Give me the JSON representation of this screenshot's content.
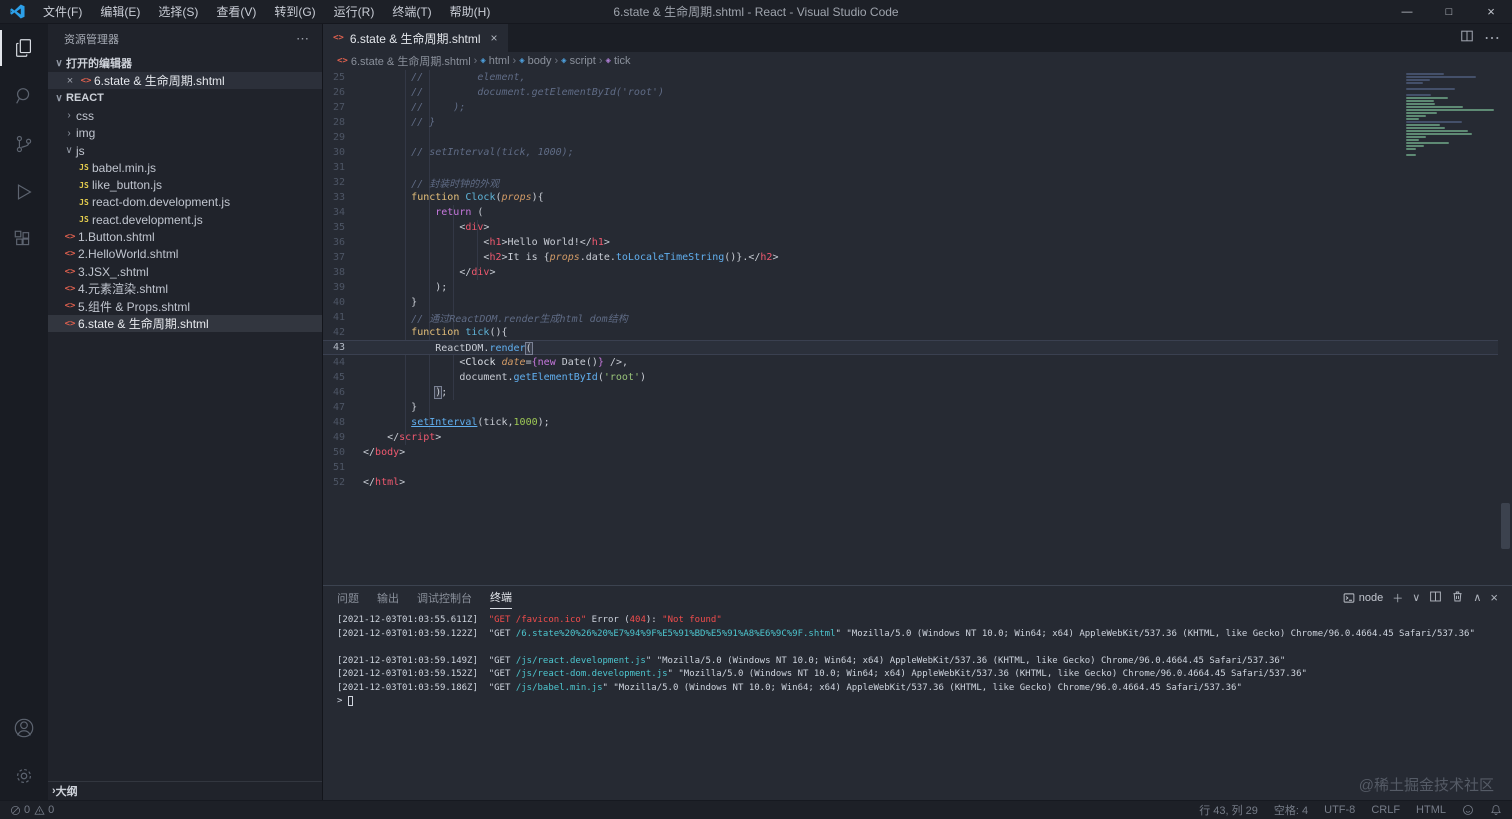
{
  "window": {
    "title": "6.state & 生命周期.shtml - React - Visual Studio Code"
  },
  "icons": {
    "more": "⋯",
    "close": "×",
    "minimize": "—",
    "maximize": "□",
    "chevron_down": "∨",
    "chevron_up": "∧",
    "chevron_right": "›",
    "plus": "＋",
    "code_badge": "<>",
    "js_badge": "JS"
  },
  "menu": {
    "items": [
      "文件(F)",
      "编辑(E)",
      "选择(S)",
      "查看(V)",
      "转到(G)",
      "运行(R)",
      "终端(T)",
      "帮助(H)"
    ]
  },
  "activity_bar": {
    "items": [
      "explorer",
      "search",
      "source-control",
      "run-debug",
      "extensions"
    ],
    "bottom": [
      "account",
      "settings"
    ]
  },
  "sidebar": {
    "title": "资源管理器",
    "open_editors_label": "打开的编辑器",
    "open_editor_file": "6.state & 生命周期.shtml",
    "project_label": "REACT",
    "tree": [
      {
        "type": "folder",
        "name": "css",
        "depth": 1,
        "expanded": false
      },
      {
        "type": "folder",
        "name": "img",
        "depth": 1,
        "expanded": false
      },
      {
        "type": "folder",
        "name": "js",
        "depth": 1,
        "expanded": true
      },
      {
        "type": "js",
        "name": "babel.min.js",
        "depth": 2
      },
      {
        "type": "js",
        "name": "like_button.js",
        "depth": 2
      },
      {
        "type": "js",
        "name": "react-dom.development.js",
        "depth": 2
      },
      {
        "type": "js",
        "name": "react.development.js",
        "depth": 2
      },
      {
        "type": "code",
        "name": "1.Button.shtml",
        "depth": 1
      },
      {
        "type": "code",
        "name": "2.HelloWorld.shtml",
        "depth": 1
      },
      {
        "type": "code",
        "name": "3.JSX_.shtml",
        "depth": 1
      },
      {
        "type": "code",
        "name": "4.元素渲染.shtml",
        "depth": 1
      },
      {
        "type": "code",
        "name": "5.组件 & Props.shtml",
        "depth": 1
      },
      {
        "type": "code",
        "name": "6.state & 生命周期.shtml",
        "depth": 1,
        "selected": true
      }
    ],
    "outline_label": "大纲"
  },
  "editor": {
    "tab": {
      "name": "6.state & 生命周期.shtml"
    },
    "breadcrumb": [
      {
        "label": "6.state & 生命周期.shtml",
        "icon": "code-file",
        "color": "#e0614f"
      },
      {
        "label": "html",
        "icon": "symbol-element",
        "color": "#4ea1df"
      },
      {
        "label": "body",
        "icon": "symbol-element",
        "color": "#4ea1df"
      },
      {
        "label": "script",
        "icon": "symbol-element",
        "color": "#4ea1df"
      },
      {
        "label": "tick",
        "icon": "symbol-method",
        "color": "#b180d7"
      }
    ],
    "active_line": 43,
    "lines": [
      {
        "n": 25,
        "t": [
          [
            "cm",
            "        //         element,"
          ]
        ]
      },
      {
        "n": 26,
        "t": [
          [
            "cm",
            "        //         document.getElementById('root')"
          ]
        ]
      },
      {
        "n": 27,
        "t": [
          [
            "cm",
            "        //     );"
          ]
        ]
      },
      {
        "n": 28,
        "t": [
          [
            "cm",
            "        // }"
          ]
        ]
      },
      {
        "n": 29,
        "t": []
      },
      {
        "n": 30,
        "t": [
          [
            "cm",
            "        // setInterval(tick, 1000);"
          ]
        ]
      },
      {
        "n": 31,
        "t": []
      },
      {
        "n": 32,
        "t": [
          [
            "cm",
            "        // 封装时钟的外观"
          ]
        ]
      },
      {
        "n": 33,
        "t": [
          [
            "pl",
            "        "
          ],
          [
            "fk",
            "function"
          ],
          [
            "pl",
            " "
          ],
          [
            "fn",
            "Clock"
          ],
          [
            "pl",
            "("
          ],
          [
            "at",
            "props"
          ],
          [
            "pl",
            "){"
          ]
        ]
      },
      {
        "n": 34,
        "t": [
          [
            "pl",
            "            "
          ],
          [
            "kw",
            "return"
          ],
          [
            "pl",
            " ("
          ]
        ]
      },
      {
        "n": 35,
        "t": [
          [
            "pl",
            "                <"
          ],
          [
            "tag",
            "div"
          ],
          [
            "pl",
            ">"
          ]
        ]
      },
      {
        "n": 36,
        "t": [
          [
            "pl",
            "                    <"
          ],
          [
            "tag",
            "h1"
          ],
          [
            "pl",
            ">Hello World!</"
          ],
          [
            "tag",
            "h1"
          ],
          [
            "pl",
            ">"
          ]
        ]
      },
      {
        "n": 37,
        "t": [
          [
            "pl",
            "                    <"
          ],
          [
            "tag",
            "h2"
          ],
          [
            "pl",
            ">It is {"
          ],
          [
            "at",
            "props"
          ],
          [
            "pl",
            ".date."
          ],
          [
            "mt",
            "toLocaleTimeString"
          ],
          [
            "pl",
            "()}.</"
          ],
          [
            "tag",
            "h2"
          ],
          [
            "pl",
            ">"
          ]
        ]
      },
      {
        "n": 38,
        "t": [
          [
            "pl",
            "                </"
          ],
          [
            "tag",
            "div"
          ],
          [
            "pl",
            ">"
          ]
        ]
      },
      {
        "n": 39,
        "t": [
          [
            "pl",
            "            );"
          ]
        ]
      },
      {
        "n": 40,
        "t": [
          [
            "pl",
            "        }"
          ]
        ]
      },
      {
        "n": 41,
        "t": [
          [
            "cm",
            "        // 通过ReactDOM.render生成html dom结构"
          ]
        ]
      },
      {
        "n": 42,
        "t": [
          [
            "pl",
            "        "
          ],
          [
            "fk",
            "function"
          ],
          [
            "pl",
            " "
          ],
          [
            "fn",
            "tick"
          ],
          [
            "pl",
            "(){"
          ]
        ]
      },
      {
        "n": 43,
        "t": [
          [
            "pl",
            "            ReactDOM."
          ],
          [
            "mt",
            "render"
          ],
          [
            "bx",
            "("
          ],
          [
            "cur",
            ""
          ]
        ]
      },
      {
        "n": 44,
        "t": [
          [
            "pl",
            "                <"
          ],
          [
            "cp",
            "Clock"
          ],
          [
            "pl",
            " "
          ],
          [
            "at",
            "date"
          ],
          [
            "pl",
            "="
          ],
          [
            "br",
            "{"
          ],
          [
            "kw",
            "new"
          ],
          [
            "pl",
            " Date()"
          ],
          [
            "br",
            "}"
          ],
          [
            "pl",
            " />,"
          ]
        ]
      },
      {
        "n": 45,
        "t": [
          [
            "pl",
            "                document."
          ],
          [
            "mt",
            "getElementById"
          ],
          [
            "pl",
            "("
          ],
          [
            "st",
            "'root'"
          ],
          [
            "pl",
            ")"
          ]
        ]
      },
      {
        "n": 46,
        "t": [
          [
            "pl",
            "            "
          ],
          [
            "bx",
            ")"
          ],
          [
            "pl",
            ";"
          ]
        ]
      },
      {
        "n": 47,
        "t": [
          [
            "pl",
            "        }"
          ]
        ]
      },
      {
        "n": 48,
        "t": [
          [
            "pl",
            "        "
          ],
          [
            "mtu",
            "setInterval"
          ],
          [
            "pl",
            "(tick,"
          ],
          [
            "nu",
            "1000"
          ],
          [
            "pl",
            ");"
          ]
        ]
      },
      {
        "n": 49,
        "t": [
          [
            "pl",
            "    </"
          ],
          [
            "tag",
            "script"
          ],
          [
            "pl",
            ">"
          ]
        ]
      },
      {
        "n": 50,
        "t": [
          [
            "pl",
            "</"
          ],
          [
            "tag",
            "body"
          ],
          [
            "pl",
            ">"
          ]
        ]
      },
      {
        "n": 51,
        "t": []
      },
      {
        "n": 52,
        "t": [
          [
            "pl",
            "</"
          ],
          [
            "tag",
            "html"
          ],
          [
            "pl",
            ">"
          ]
        ]
      }
    ]
  },
  "panel": {
    "tabs": [
      "问题",
      "输出",
      "调试控制台",
      "终端"
    ],
    "active_tab": "终端",
    "shell": "node"
  },
  "terminal": {
    "lines": [
      [
        [
          "tm",
          "[2021-12-03T01:03:55.611Z]  "
        ],
        [
          "er",
          "\"GET /favicon.ico\""
        ],
        [
          "tm",
          " Error ("
        ],
        [
          "er",
          "404"
        ],
        [
          "tm",
          "): "
        ],
        [
          "er",
          "\"Not found\""
        ]
      ],
      [
        [
          "tm",
          "[2021-12-03T01:03:59.122Z]  \"GET "
        ],
        [
          "pa",
          "/6.state%20%26%20%E7%94%9F%E5%91%BD%E5%91%A8%E6%9C%9F.shtml"
        ],
        [
          "tm",
          "\" \"Mozilla/5.0 (Windows NT 10.0; Win64; x64) AppleWebKit/537.36 (KHTML, like Gecko) Chrome/96.0.4664.45 Safari/537.36\""
        ]
      ],
      [],
      [
        [
          "tm",
          "[2021-12-03T01:03:59.149Z]  \"GET "
        ],
        [
          "pa",
          "/js/react.development.js"
        ],
        [
          "tm",
          "\" \"Mozilla/5.0 (Windows NT 10.0; Win64; x64) AppleWebKit/537.36 (KHTML, like Gecko) Chrome/96.0.4664.45 Safari/537.36\""
        ]
      ],
      [
        [
          "tm",
          "[2021-12-03T01:03:59.152Z]  \"GET "
        ],
        [
          "pa",
          "/js/react-dom.development.js"
        ],
        [
          "tm",
          "\" \"Mozilla/5.0 (Windows NT 10.0; Win64; x64) AppleWebKit/537.36 (KHTML, like Gecko) Chrome/96.0.4664.45 Safari/537.36\""
        ]
      ],
      [
        [
          "tm",
          "[2021-12-03T01:03:59.186Z]  \"GET "
        ],
        [
          "pa",
          "/js/babel.min.js"
        ],
        [
          "tm",
          "\" \"Mozilla/5.0 (Windows NT 10.0; Win64; x64) AppleWebKit/537.36 (KHTML, like Gecko) Chrome/96.0.4664.45 Safari/537.36\""
        ]
      ]
    ],
    "prompt": "> "
  },
  "status_bar": {
    "errors": "0",
    "warnings": "0",
    "line_col": "行 43, 列 29",
    "spaces": "空格: 4",
    "encoding": "UTF-8",
    "eol": "CRLF",
    "language": "HTML"
  },
  "watermark": "@稀土掘金技术社区"
}
